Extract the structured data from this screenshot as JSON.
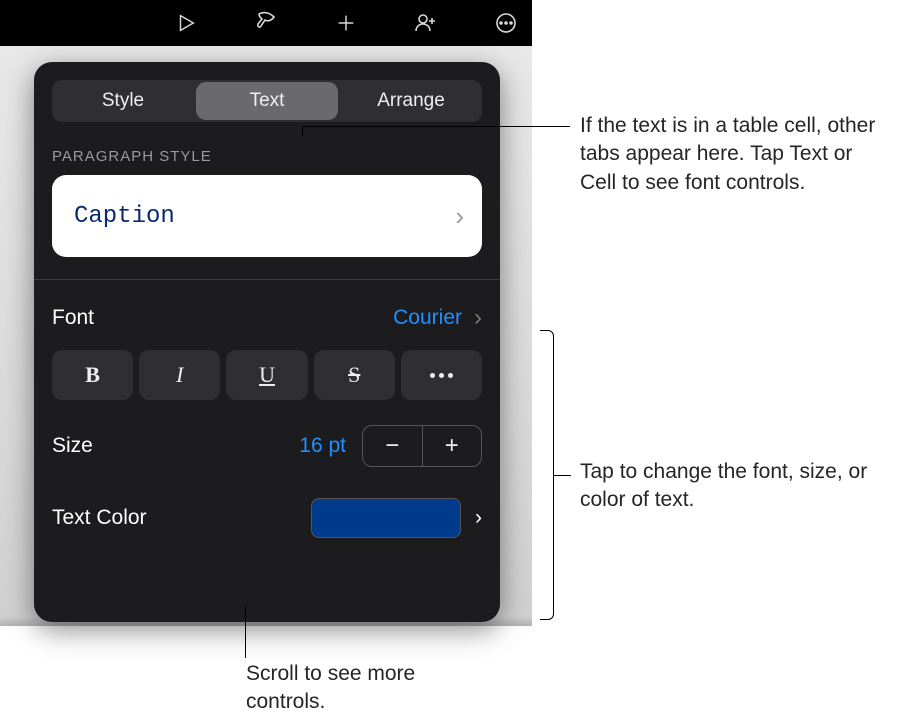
{
  "toolbar_icons": [
    "play-icon",
    "format-brush-icon",
    "plus-icon",
    "add-people-icon",
    "more-icon"
  ],
  "tabs": {
    "style": "Style",
    "text": "Text",
    "arrange": "Arrange",
    "selected": 1
  },
  "paragraph_style": {
    "section_label": "PARAGRAPH STYLE",
    "value": "Caption"
  },
  "font": {
    "label": "Font",
    "value": "Courier"
  },
  "style_buttons": {
    "bold": "B",
    "italic": "I",
    "underline": "U",
    "strike": "S"
  },
  "size": {
    "label": "Size",
    "value": "16 pt"
  },
  "text_color": {
    "label": "Text Color",
    "hex": "#003a8c"
  },
  "callouts": {
    "tabs": "If the text is in a table cell, other tabs appear here. Tap Text or Cell to see font controls.",
    "body": "Tap to change the font, size, or color of text.",
    "scroll": "Scroll to see more controls."
  }
}
